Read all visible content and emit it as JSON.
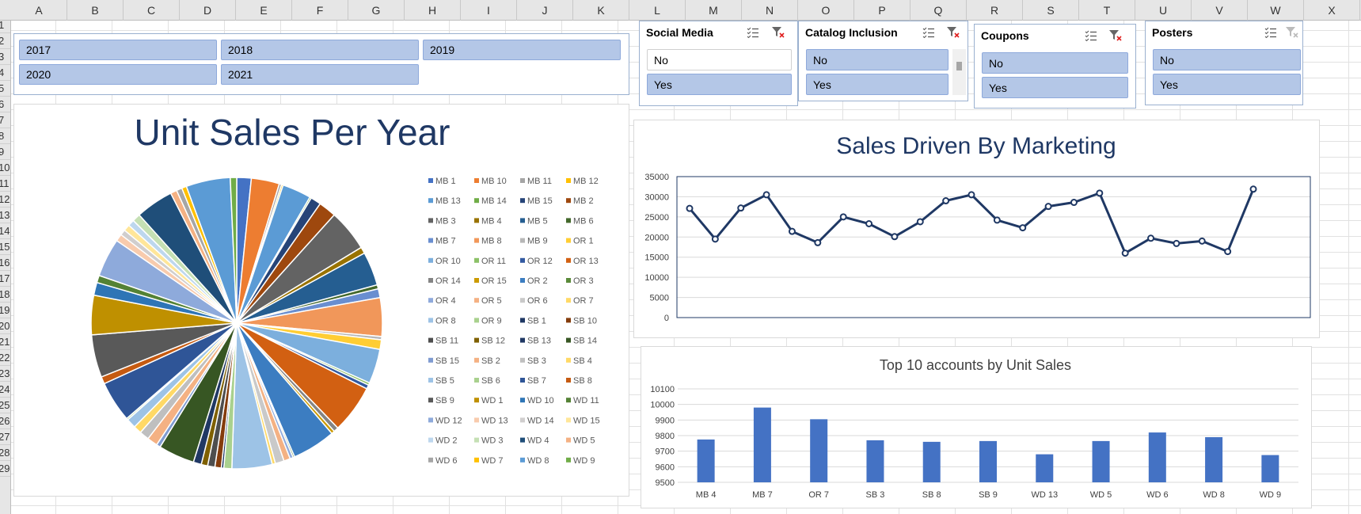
{
  "columns": [
    "A",
    "B",
    "C",
    "D",
    "E",
    "F",
    "G",
    "H",
    "I",
    "J",
    "K",
    "L",
    "M",
    "N",
    "O",
    "P",
    "Q",
    "R",
    "S",
    "T",
    "U",
    "V",
    "W",
    "X"
  ],
  "rows": [
    "1",
    "2",
    "3",
    "4",
    "5",
    "6",
    "7",
    "8",
    "9",
    "10",
    "11",
    "12",
    "13",
    "14",
    "15",
    "16",
    "17",
    "18",
    "19",
    "20",
    "21",
    "22",
    "23",
    "24",
    "25",
    "26",
    "27",
    "28",
    "29"
  ],
  "year_slicer": {
    "items": [
      {
        "label": "2017",
        "selected": true
      },
      {
        "label": "2018",
        "selected": true
      },
      {
        "label": "2019",
        "selected": true
      },
      {
        "label": "2020",
        "selected": true
      },
      {
        "label": "2021",
        "selected": true
      }
    ]
  },
  "slicers": [
    {
      "title": "Social Media",
      "items": [
        {
          "label": "No",
          "selected": false
        },
        {
          "label": "Yes",
          "selected": true
        }
      ]
    },
    {
      "title": "Catalog Inclusion",
      "items": [
        {
          "label": "No",
          "selected": true
        },
        {
          "label": "Yes",
          "selected": true
        }
      ]
    },
    {
      "title": "Coupons",
      "items": [
        {
          "label": "No",
          "selected": true
        },
        {
          "label": "Yes",
          "selected": true
        }
      ]
    },
    {
      "title": "Posters",
      "items": [
        {
          "label": "No",
          "selected": true
        },
        {
          "label": "Yes",
          "selected": true
        }
      ]
    }
  ],
  "colors": {
    "selected_tile": "#b4c7e7",
    "line_series": "#1f3864",
    "bar_series": "#4472c4",
    "title_dark": "#1f3864"
  },
  "chart_data": [
    {
      "type": "pie",
      "title": "Unit Sales Per Year",
      "legend_position": "right",
      "categories": [
        "MB 1",
        "MB 10",
        "MB 11",
        "MB 12",
        "MB 13",
        "MB 14",
        "MB 15",
        "MB 2",
        "MB 3",
        "MB 4",
        "MB 5",
        "MB 6",
        "MB 7",
        "MB 8",
        "MB 9",
        "OR 1",
        "OR 10",
        "OR 11",
        "OR 12",
        "OR 13",
        "OR 14",
        "OR 15",
        "OR 2",
        "OR 3",
        "OR 4",
        "OR 5",
        "OR 6",
        "OR 7",
        "OR 8",
        "OR 9",
        "SB 1",
        "SB 10",
        "SB 11",
        "SB 12",
        "SB 13",
        "SB 14",
        "SB 15",
        "SB 2",
        "SB 3",
        "SB 4",
        "SB 5",
        "SB 6",
        "SB 7",
        "SB 8",
        "SB 9",
        "WD 1",
        "WD 10",
        "WD 11",
        "WD 12",
        "WD 13",
        "WD 14",
        "WD 15",
        "WD 2",
        "WD 3",
        "WD 4",
        "WD 5",
        "WD 6",
        "WD 7",
        "WD 8",
        "WD 9"
      ],
      "values": [
        1.8,
        3.5,
        0.3,
        0.2,
        3.6,
        0.2,
        1.3,
        2.2,
        5.2,
        0.8,
        4.2,
        0.5,
        1.1,
        4.8,
        0.4,
        1.2,
        4.3,
        0.3,
        0.5,
        6.0,
        0.6,
        0.4,
        5.4,
        0.2,
        0.4,
        0.8,
        1.1,
        0.4,
        5.0,
        1.0,
        0.3,
        0.8,
        0.9,
        0.8,
        1.0,
        4.5,
        0.5,
        1.3,
        1.2,
        1.0,
        1.2,
        0.2,
        5.1,
        0.9,
        5.3,
        4.9,
        1.6,
        0.9,
        4.8,
        0.9,
        0.7,
        0.8,
        0.8,
        1.0,
        4.7,
        0.8,
        0.7,
        0.6,
        5.5,
        0.8
      ],
      "colors": [
        "#4472c4",
        "#ed7d31",
        "#a5a5a5",
        "#ffc000",
        "#5b9bd5",
        "#70ad47",
        "#264478",
        "#9e480e",
        "#636363",
        "#997300",
        "#255e91",
        "#43682b",
        "#698ed0",
        "#f1975a",
        "#b7b7b7",
        "#ffcd33",
        "#7cafdd",
        "#8cc168",
        "#335aa1",
        "#d26012",
        "#848484",
        "#cc9a00",
        "#3c7dc1",
        "#5a8a39",
        "#8faadc",
        "#f4b183",
        "#c9c9c9",
        "#ffd966",
        "#9dc3e6",
        "#a9d18e",
        "#1f3864",
        "#843c0c",
        "#4e4e4e",
        "#7f6000",
        "#203864",
        "#375623",
        "#7f9bd1",
        "#f4b183",
        "#bfbfbf",
        "#ffd966",
        "#9dc3e6",
        "#a9d18e",
        "#2f5597",
        "#c55a11",
        "#595959",
        "#bf9000",
        "#2e75b6",
        "#548235",
        "#8eaadb",
        "#f8cbad",
        "#d0cece",
        "#ffe699",
        "#bdd7ee",
        "#c5e0b4",
        "#1f4e79",
        "#f4b183",
        "#a6a6a6",
        "#ffc000",
        "#5b9bd5",
        "#70ad47"
      ]
    },
    {
      "type": "line",
      "title": "Sales Driven By Marketing",
      "ylim": [
        0,
        35000
      ],
      "yticks": [
        0,
        5000,
        10000,
        15000,
        20000,
        25000,
        30000,
        35000
      ],
      "values": [
        27100,
        19500,
        27200,
        30500,
        21400,
        18600,
        25000,
        23300,
        20100,
        23800,
        29000,
        30500,
        24200,
        22300,
        27600,
        28600,
        30900,
        16000,
        19700,
        18400,
        19000,
        16400,
        31900
      ]
    },
    {
      "type": "bar",
      "title": "Top 10 accounts by Unit Sales",
      "categories": [
        "MB 4",
        "MB 7",
        "OR 7",
        "SB 3",
        "SB 8",
        "SB 9",
        "WD 13",
        "WD 5",
        "WD 6",
        "WD 8",
        "WD 9"
      ],
      "values": [
        9775,
        9980,
        9905,
        9770,
        9760,
        9765,
        9680,
        9765,
        9820,
        9790,
        9675
      ],
      "ylim": [
        9500,
        10100
      ],
      "yticks": [
        9500,
        9600,
        9700,
        9800,
        9900,
        10000,
        10100
      ]
    }
  ]
}
